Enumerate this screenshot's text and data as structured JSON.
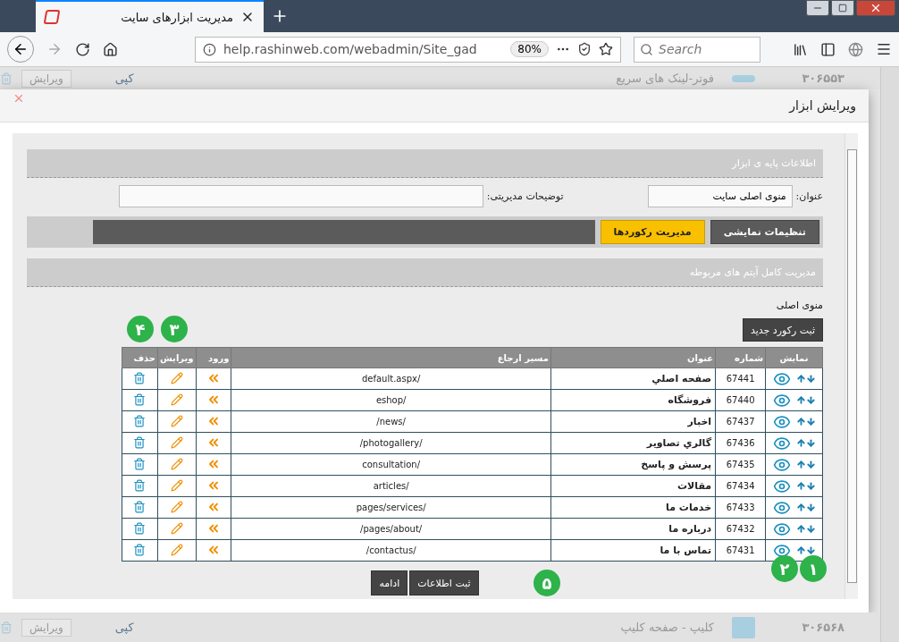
{
  "browser": {
    "tab_title": "مدیریت ابزارهای سایت",
    "url": "help.rashinweb.com/webadmin/Site_gad",
    "zoom": "80%",
    "search_placeholder": "Search"
  },
  "background_rows": [
    {
      "number": "۳۰۶۵۵۳",
      "title": "فوتر-لینک های سریع",
      "copy": "کپی",
      "edit": "ویرایش"
    },
    {
      "number": "۳۰۶۵۶۸",
      "title": "کلیپ - صفحه کلیپ",
      "copy": "کپی",
      "edit": "ویرایش"
    }
  ],
  "modal": {
    "title": "ویرایش ابزار",
    "basic_section": {
      "title": "اطلاعات پایه ی ابزار",
      "fields": [
        {
          "label": "عنوان:",
          "value": "منوی اصلی سایت"
        },
        {
          "label": "توضیحات مدیریتی:"
        }
      ]
    },
    "tabs": [
      {
        "label": "تنظیمات نمایشی",
        "selected": false
      },
      {
        "label": "مدیریت رکوردها",
        "selected": true
      }
    ],
    "items_section": {
      "title": "مدیریت کامل آیتم های مربوطه",
      "menu_name": "منوی اصلی",
      "new_record_button": "ثبت رکورد جدید"
    },
    "table": {
      "columns": [
        "نمایش",
        "شماره",
        "عنوان",
        "مسیر ارجاع",
        "ورود",
        "ویرایش",
        "حذف"
      ],
      "rows": [
        {
          "number": "67441",
          "title": "صفحه اصلي",
          "path": "/default.aspx"
        },
        {
          "number": "67440",
          "title": "فروشگاه",
          "path": "/eshop"
        },
        {
          "number": "67437",
          "title": "اخبار",
          "path": "/news/"
        },
        {
          "number": "67436",
          "title": "گالري تصاوير",
          "path": "/photogallery/"
        },
        {
          "number": "67435",
          "title": "پرسش و پاسخ",
          "path": "/consultation"
        },
        {
          "number": "67434",
          "title": "مقالات",
          "path": "/articles"
        },
        {
          "number": "67433",
          "title": "خدمات ما",
          "path": "/pages/services"
        },
        {
          "number": "67432",
          "title": "درباره ما",
          "path": "/pages/about/"
        },
        {
          "number": "67431",
          "title": "تماس با ما",
          "path": "/contactus/"
        }
      ]
    },
    "footer_buttons": [
      "ثبت اطلاعات",
      "ادامه"
    ]
  },
  "callouts": [
    "۱",
    "۲",
    "۳",
    "۴",
    "۵"
  ]
}
